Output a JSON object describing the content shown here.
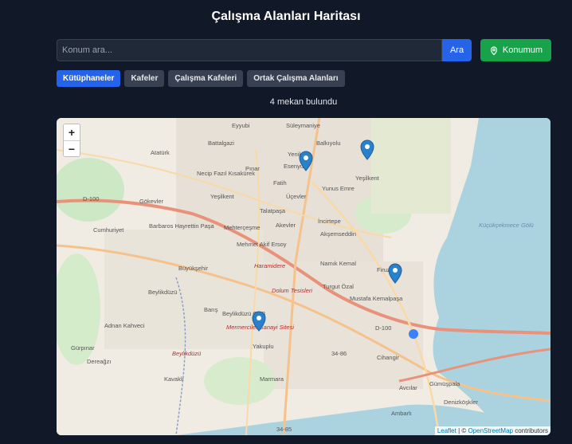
{
  "header": {
    "title": "Çalışma Alanları Haritası"
  },
  "search": {
    "placeholder": "Konum ara...",
    "button_label": "Ara"
  },
  "location_button": {
    "label": "Konumum",
    "icon": "map-pin-icon"
  },
  "filters": [
    {
      "label": "Kütüphaneler",
      "active": true
    },
    {
      "label": "Kafeler",
      "active": false
    },
    {
      "label": "Çalışma Kafeleri",
      "active": false
    },
    {
      "label": "Ortak Çalışma Alanları",
      "active": false
    }
  ],
  "result_count": "4 mekan bulundu",
  "map": {
    "zoom_in": "+",
    "zoom_out": "−",
    "attribution": {
      "leaflet": "Leaflet",
      "sep": " | © ",
      "osm": "OpenStreetMap",
      "suffix": " contributors"
    },
    "place_labels": [
      "Eyyubi",
      "Süleymaniye",
      "Battalgazi",
      "Balkıyolu",
      "Yenikent",
      "Esenyurt",
      "Atatürk",
      "Necip Fazıl Kısakürek",
      "Pınar",
      "Fatih",
      "Yeşilkent",
      "Üçevler",
      "Yunus Emre",
      "Yeşilkent",
      "Talatpaşa",
      "Gökevler",
      "İncirtepe",
      "Barbaros Hayrettin Paşa",
      "Mehterçeşme",
      "Akevler",
      "Akşemseddin",
      "Cumhuriyet",
      "Mehmet Akif Ersoy",
      "Namık Kemal",
      "Firuzköy",
      "Büyükşehir",
      "Turgut Özal",
      "Mustafa Kemalpaşa",
      "Beylikdüzü",
      "Barış",
      "Beylikdüzü OSB",
      "Adnan Kahveci",
      "Cihangir",
      "Gürpınar",
      "Yakuplu",
      "Dereağzı",
      "Kavaklı",
      "Marmara",
      "Gümüşpala",
      "Avcılar",
      "Denizköşkler",
      "Ambarlı",
      "Küçükçekmece Gölü",
      "Haramidere",
      "Dolum Tesisleri",
      "Mermerciler Sanayi Sitesi",
      "Beylikdüzü",
      "D-100",
      "D-100",
      "34-86",
      "34-85"
    ],
    "markers": [
      {
        "name": "Esenyurt"
      },
      {
        "name": "Yeşilkent"
      },
      {
        "name": "Mustafa Kemalpaşa"
      },
      {
        "name": "Yakuplu"
      }
    ],
    "colors": {
      "marker": "#2a81cb",
      "user_location": "#3b82f6",
      "water": "#aad3df",
      "motorway": "#e8927c"
    }
  }
}
